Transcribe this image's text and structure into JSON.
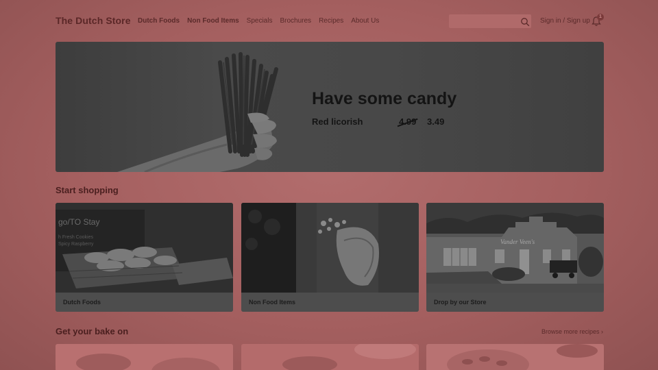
{
  "header": {
    "logo": "The Dutch Store",
    "nav": [
      {
        "label": "Dutch Foods",
        "bold": true
      },
      {
        "label": "Non Food Items",
        "bold": true
      },
      {
        "label": "Specials",
        "bold": false
      },
      {
        "label": "Brochures",
        "bold": false
      },
      {
        "label": "Recipes",
        "bold": false
      },
      {
        "label": "About Us",
        "bold": false
      }
    ],
    "search_icon": "search-icon",
    "signin_label": "Sign in / Sign up",
    "bell_icon": "bell-icon",
    "notification_count": "1"
  },
  "hero": {
    "title": "Have some candy",
    "product": "Red licorish",
    "old_price": "4.99",
    "new_price": "3.49"
  },
  "sections": {
    "shop_title": "Start shopping",
    "cards": [
      {
        "label": "Dutch Foods"
      },
      {
        "label": "Non Food Items"
      },
      {
        "label": "Drop by our Store"
      }
    ],
    "bake_title": "Get your bake on",
    "browse_link": "Browse more recipes ›"
  },
  "colors": {
    "overlay": "#a76363",
    "hero_bg": "#454545",
    "text_dark": "#141414"
  }
}
